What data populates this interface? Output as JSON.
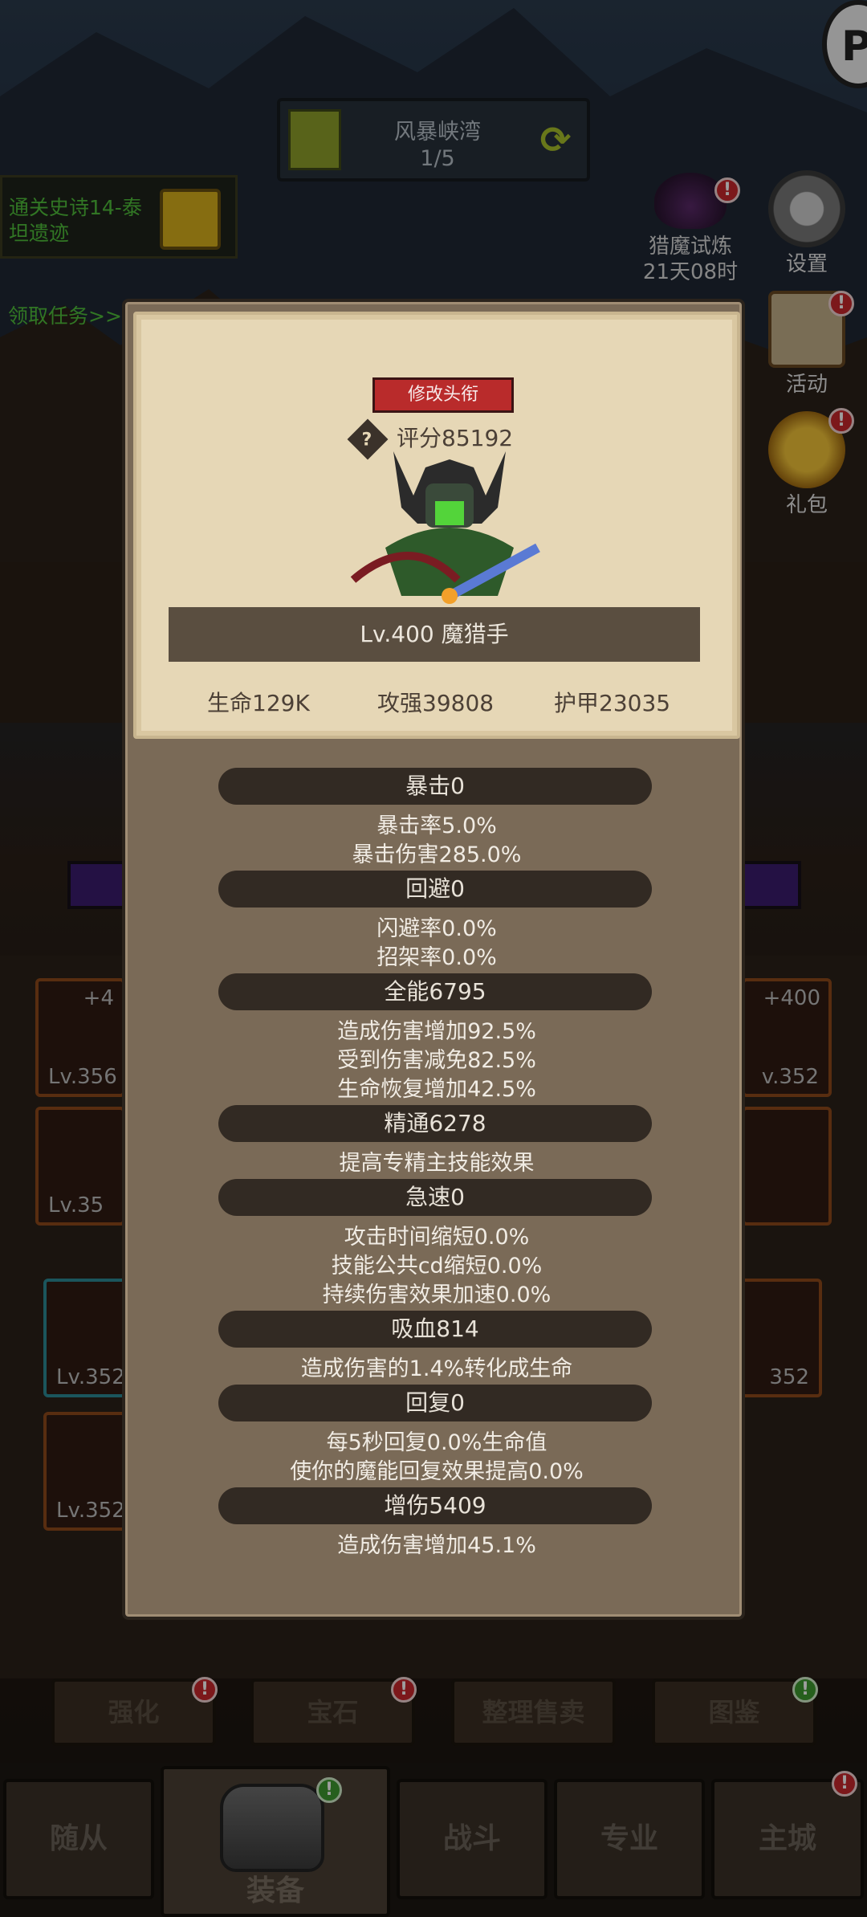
{
  "top_bar": {
    "location_name": "风暴峡湾",
    "location_progress": "1/5",
    "refresh_icon": "refresh-icon"
  },
  "quest": {
    "text": "通关史诗14-泰坦遗迹",
    "link": "领取任务>>"
  },
  "hunt": {
    "label": "猎魔试炼",
    "timer": "21天08时"
  },
  "side_buttons": [
    {
      "label": "设置",
      "icon": "gear-icon"
    },
    {
      "label": "活动",
      "icon": "scroll-icon"
    },
    {
      "label": "礼包",
      "icon": "gift-icon"
    }
  ],
  "corner": {
    "label": "P"
  },
  "slots": {
    "left": [
      {
        "plus": "+4",
        "level": "Lv.356"
      },
      {
        "level": "Lv.35"
      }
    ],
    "right": [
      {
        "plus": "+400",
        "level": "v.352"
      }
    ],
    "bag_left": [
      {
        "level": "Lv.352"
      },
      {
        "level": "Lv.352"
      }
    ],
    "bag_right": [
      {
        "level": "352"
      }
    ]
  },
  "actions": [
    {
      "label": "强化"
    },
    {
      "label": "宝石"
    },
    {
      "label": "整理售卖"
    },
    {
      "label": "图鉴"
    }
  ],
  "tabs": [
    {
      "label": "随从"
    },
    {
      "label": "装备"
    },
    {
      "label": "战斗"
    },
    {
      "label": "专业"
    },
    {
      "label": "主城"
    }
  ],
  "badge_mark": "!",
  "panel": {
    "title_button": "修改头衔",
    "score": "评分85192",
    "help_mark": "?",
    "name": "Lv.400 魔猎手",
    "stats": [
      "生命129K",
      "攻强39808",
      "护甲23035"
    ],
    "sections": [
      {
        "header": "暴击0",
        "lines": [
          "暴击率5.0%",
          "暴击伤害285.0%"
        ]
      },
      {
        "header": "回避0",
        "lines": [
          "闪避率0.0%",
          "招架率0.0%"
        ]
      },
      {
        "header": "全能6795",
        "lines": [
          "造成伤害增加92.5%",
          "受到伤害减免82.5%",
          "生命恢复增加42.5%"
        ]
      },
      {
        "header": "精通6278",
        "lines": [
          "提高专精主技能效果"
        ]
      },
      {
        "header": "急速0",
        "lines": [
          "攻击时间缩短0.0%",
          "技能公共cd缩短0.0%",
          "持续伤害效果加速0.0%"
        ]
      },
      {
        "header": "吸血814",
        "lines": [
          "造成伤害的1.4%转化成生命"
        ]
      },
      {
        "header": "回复0",
        "lines": [
          "每5秒回复0.0%生命值",
          "使你的魔能回复效果提高0.0%"
        ]
      },
      {
        "header": "增伤5409",
        "lines": [
          "造成伤害增加45.1%"
        ]
      }
    ]
  }
}
